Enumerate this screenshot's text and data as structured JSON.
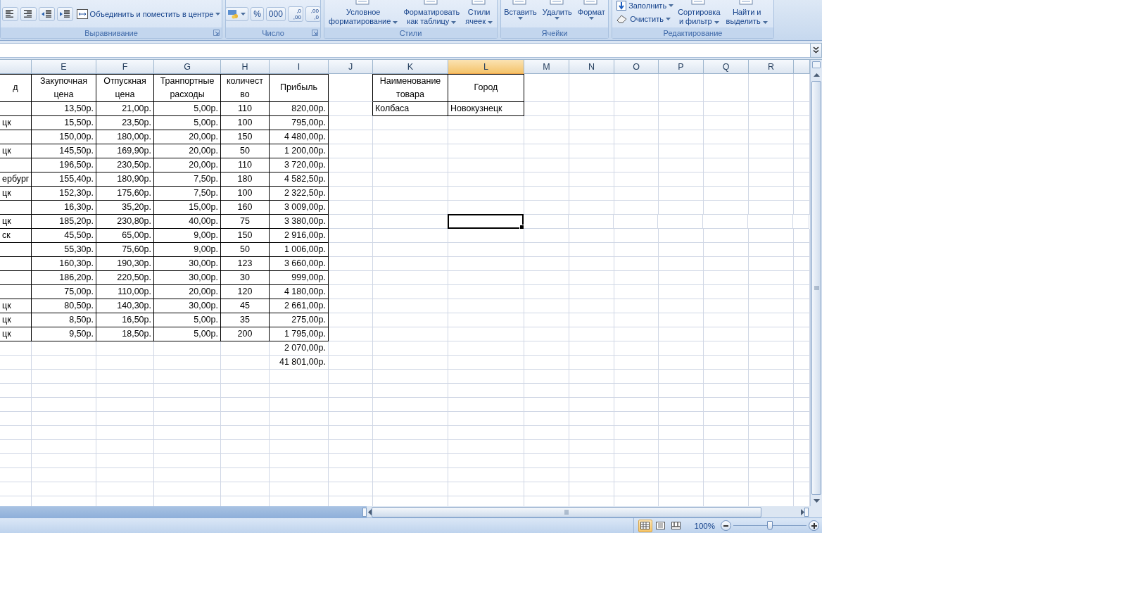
{
  "ribbon": {
    "groups": [
      {
        "label": "Выравнивание",
        "launcher": true,
        "items": [
          {
            "kind": "align_left"
          },
          {
            "kind": "align_right"
          },
          {
            "kind": "outdent"
          },
          {
            "kind": "indent"
          },
          {
            "kind": "merge",
            "label": "Объединить и поместить в центре",
            "dropdown": true
          }
        ]
      },
      {
        "label": "Число",
        "launcher": true,
        "items": [
          {
            "kind": "currency",
            "dropdown": true
          },
          {
            "kind": "text",
            "label": "%"
          },
          {
            "kind": "text",
            "label": "000"
          },
          {
            "kind": "decimal",
            "top": ",0",
            "bottom": ",00"
          },
          {
            "kind": "decimal",
            "top": ",00",
            "bottom": ",0"
          }
        ]
      },
      {
        "label": "Стили",
        "launcher": false,
        "items": [
          {
            "kind": "large",
            "lines": [
              "Условное",
              "форматирование"
            ],
            "dropdown": true
          },
          {
            "kind": "large",
            "lines": [
              "Форматировать",
              "как таблицу"
            ],
            "dropdown": true
          },
          {
            "kind": "large",
            "lines": [
              "Стили",
              "ячеек"
            ],
            "dropdown": true
          }
        ]
      },
      {
        "label": "Ячейки",
        "launcher": false,
        "items": [
          {
            "kind": "large",
            "lines": [
              "Вставить"
            ],
            "dropdown": true
          },
          {
            "kind": "large",
            "lines": [
              "Удалить"
            ],
            "dropdown": true
          },
          {
            "kind": "large",
            "lines": [
              "Формат"
            ],
            "dropdown": true
          }
        ]
      },
      {
        "label": "Редактирование",
        "launcher": false,
        "items": [
          {
            "kind": "small_stack",
            "buttons": [
              {
                "kind": "fill",
                "label": "Заполнить",
                "dropdown": true
              },
              {
                "kind": "clear",
                "label": "Очистить",
                "dropdown": true
              }
            ]
          },
          {
            "kind": "large",
            "lines": [
              "Сортировка",
              "и фильтр"
            ],
            "dropdown": true
          },
          {
            "kind": "large",
            "lines": [
              "Найти и",
              "выделить"
            ],
            "dropdown": true
          }
        ]
      }
    ]
  },
  "sheet": {
    "columns": [
      {
        "letter": "E",
        "selected": false
      },
      {
        "letter": "F",
        "selected": false
      },
      {
        "letter": "G",
        "selected": false
      },
      {
        "letter": "H",
        "selected": false
      },
      {
        "letter": "I",
        "selected": false
      },
      {
        "letter": "J",
        "selected": false
      },
      {
        "letter": "K",
        "selected": false
      },
      {
        "letter": "L",
        "selected": true
      },
      {
        "letter": "M",
        "selected": false
      },
      {
        "letter": "N",
        "selected": false
      },
      {
        "letter": "O",
        "selected": false
      },
      {
        "letter": "P",
        "selected": false
      },
      {
        "letter": "Q",
        "selected": false
      },
      {
        "letter": "R",
        "selected": false
      }
    ]
  },
  "main_table": {
    "header": [
      [
        "д"
      ],
      [
        "Закупочная",
        "цена"
      ],
      [
        "Отпускная",
        "цена"
      ],
      [
        "Транпортные",
        "расходы"
      ],
      [
        "количест",
        "во"
      ],
      [
        "Прибыль"
      ]
    ],
    "rows": [
      {
        "active": false,
        "cells": [
          null,
          "13,50р.",
          "21,00р.",
          "5,00р.",
          "110",
          "820,00р."
        ]
      },
      {
        "active": false,
        "cells": [
          "цк",
          "15,50р.",
          "23,50р.",
          "5,00р.",
          "100",
          "795,00р."
        ]
      },
      {
        "active": false,
        "cells": [
          null,
          "150,00р.",
          "180,00р.",
          "20,00р.",
          "150",
          "4 480,00р."
        ]
      },
      {
        "active": false,
        "cells": [
          "цк",
          "145,50р.",
          "169,90р.",
          "20,00р.",
          "50",
          "1 200,00р."
        ]
      },
      {
        "active": false,
        "cells": [
          null,
          "196,50р.",
          "230,50р.",
          "20,00р.",
          "110",
          "3 720,00р."
        ]
      },
      {
        "active": false,
        "cells": [
          "ербург",
          "155,40р.",
          "180,90р.",
          "7,50р.",
          "180",
          "4 582,50р."
        ]
      },
      {
        "active": false,
        "cells": [
          "цк",
          "152,30р.",
          "175,60р.",
          "7,50р.",
          "100",
          "2 322,50р."
        ]
      },
      {
        "active": false,
        "cells": [
          null,
          "16,30р.",
          "35,20р.",
          "15,00р.",
          "160",
          "3 009,00р."
        ]
      },
      {
        "active": true,
        "cells": [
          "цк",
          "185,20р.",
          "230,80р.",
          "40,00р.",
          "75",
          "3 380,00р."
        ]
      },
      {
        "active": false,
        "cells": [
          "ск",
          "45,50р.",
          "65,00р.",
          "9,00р.",
          "150",
          "2 916,00р."
        ]
      },
      {
        "active": false,
        "cells": [
          null,
          "55,30р.",
          "75,60р.",
          "9,00р.",
          "50",
          "1 006,00р."
        ]
      },
      {
        "active": false,
        "cells": [
          null,
          "160,30р.",
          "190,30р.",
          "30,00р.",
          "123",
          "3 660,00р."
        ]
      },
      {
        "active": false,
        "cells": [
          null,
          "186,20р.",
          "220,50р.",
          "30,00р.",
          "30",
          "999,00р."
        ]
      },
      {
        "active": false,
        "cells": [
          null,
          "75,00р.",
          "110,00р.",
          "20,00р.",
          "120",
          "4 180,00р."
        ]
      },
      {
        "active": false,
        "cells": [
          "цк",
          "80,50р.",
          "140,30р.",
          "30,00р.",
          "45",
          "2 661,00р."
        ]
      },
      {
        "active": false,
        "cells": [
          "цк",
          "8,50р.",
          "16,50р.",
          "5,00р.",
          "35",
          "275,00р."
        ]
      },
      {
        "active": false,
        "cells": [
          "цк",
          "9,50р.",
          "18,50р.",
          "5,00р.",
          "200",
          "1 795,00р."
        ]
      }
    ],
    "totals": [
      "2 070,00р.",
      "41 801,00р."
    ]
  },
  "side_table": {
    "header": [
      [
        "Наименование",
        "товара"
      ],
      [
        "Город"
      ]
    ],
    "rows": [
      {
        "cells": [
          "Колбаса",
          "Новокузнецк"
        ]
      }
    ]
  },
  "status_bar": {
    "views": [
      {
        "selected": true
      },
      {
        "selected": false
      },
      {
        "selected": false
      }
    ],
    "zoom": {
      "label": "100%",
      "level": 0.5
    }
  }
}
